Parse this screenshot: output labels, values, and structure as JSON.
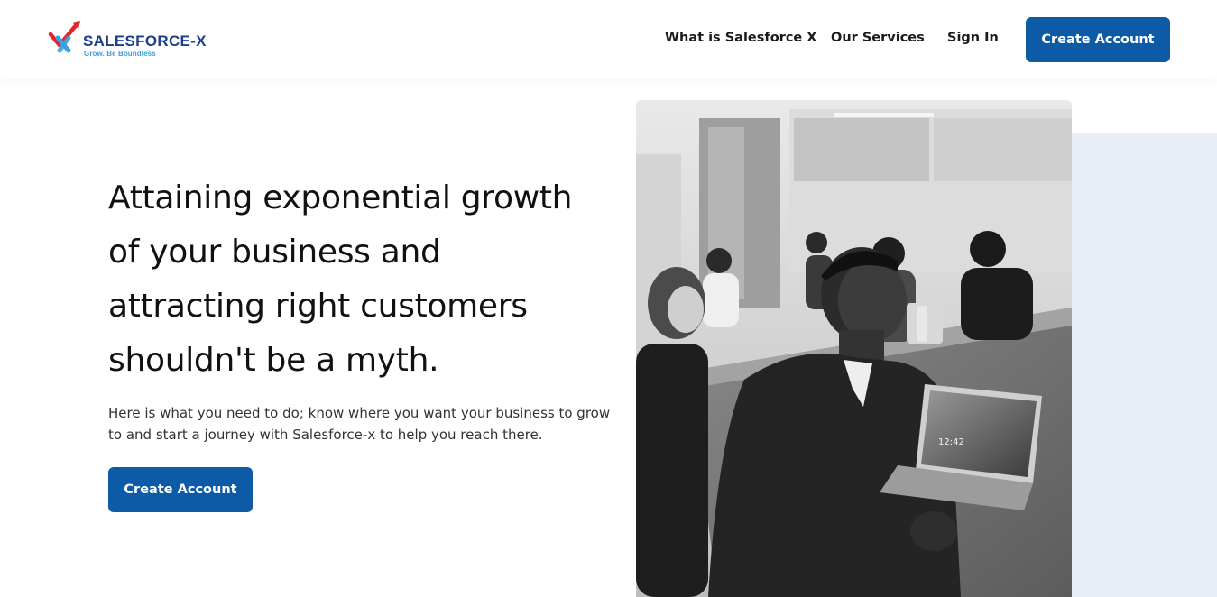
{
  "brand": {
    "name": "SALESFORCE-X",
    "tagline": "Grow. Be Boundless",
    "colors": {
      "primary": "#0d5aa7",
      "logo_text": "#1c3f8c",
      "logo_accent": "#e0262b",
      "logo_light": "#3aa0e4"
    }
  },
  "nav": {
    "links": [
      "What is Salesforce X",
      "Our Services",
      "Sign In"
    ],
    "cta": "Create Account"
  },
  "hero": {
    "title_lines": [
      "Attaining exponential growth",
      "of your business and",
      "attracting right customers",
      "shouldn't be a myth."
    ],
    "description": "Here is what you need to do; know where you want your business to grow to and start a journey with Salesforce-x to help you reach there.",
    "cta": "Create Account",
    "image": {
      "kind": "photo",
      "subject": "team meeting around conference table with laptop",
      "tone": "black-and-white"
    },
    "laptop_clock": "12:42"
  }
}
